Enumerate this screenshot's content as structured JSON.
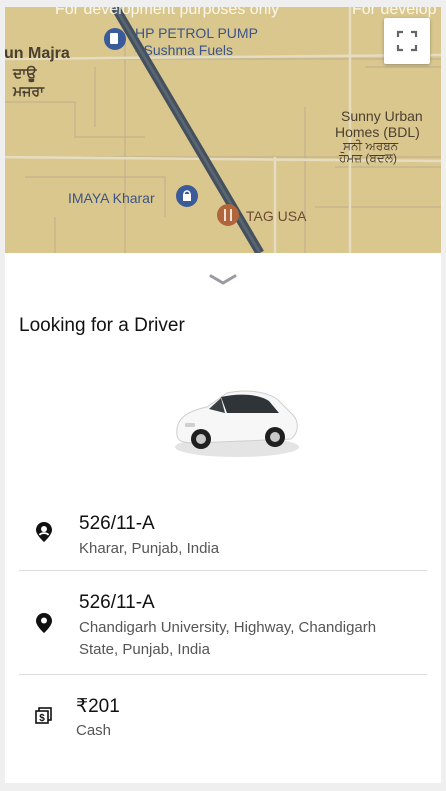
{
  "map": {
    "dev_watermark_left": "For development purposes only",
    "dev_watermark_right": "For develop",
    "labels": {
      "village_en": "un Majra",
      "village_pa_1": "ਦਾਊ",
      "village_pa_2": "ਮਜਰਾ",
      "petrol_1": "HP PETROL PUMP",
      "petrol_2": "- Sushma Fuels",
      "homes_1": "Sunny Urban",
      "homes_2": "Homes (BDL)",
      "homes_pa_1": "ਸਨੀ ਅਰਬਨ",
      "homes_pa_2": "ਹੋਮਜ਼ (ਬਦਲ)",
      "imaya": "IMAYA Kharar",
      "tag": "TAG USA"
    },
    "colors": {
      "land": "#d9c78e",
      "road": "#45505d"
    }
  },
  "sheet": {
    "title": "Looking for a Driver",
    "pickup": {
      "title": "526/11-A",
      "address": "Kharar, Punjab, India"
    },
    "dropoff": {
      "title": "526/11-A",
      "address_line1": "Chandigarh University, Highway, Chandigarh",
      "address_line2": "State, Punjab, India"
    },
    "payment": {
      "amount": "₹201",
      "method": "Cash"
    }
  },
  "icons": [
    "fullscreen-icon",
    "chevron-down-icon",
    "car-image",
    "pickup-pin-icon",
    "dropoff-pin-icon",
    "cash-icon"
  ]
}
